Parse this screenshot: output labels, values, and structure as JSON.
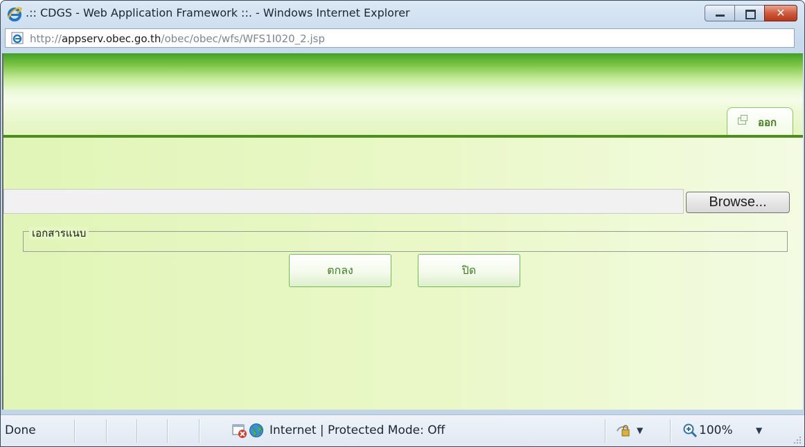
{
  "window": {
    "title": ".:: CDGS - Web Application Framework ::. - Windows Internet Explorer",
    "controls": {
      "minimize": "minimize",
      "maximize": "maximize",
      "close": "✕"
    }
  },
  "address": {
    "prefix": "http://",
    "host": "appserv.obec.go.th",
    "path": "/obec/obec/wfs/WFS1I020_2.jsp"
  },
  "page": {
    "logout_label": "ออก",
    "file_input_value": "",
    "browse_label": "Browse...",
    "attachment_legend": "เอกสารแนบ",
    "ok_label": "ตกลง",
    "close_label": "ปิด"
  },
  "status": {
    "text": "Done",
    "zone": "Internet | Protected Mode: Off",
    "zoom": "100%"
  },
  "icons": {
    "app": "internet-explorer-icon",
    "page": "internet-explorer-page-icon",
    "logout": "window-icon",
    "blocker": "popup-blocked-icon",
    "zone": "globe-icon",
    "protected": "protected-mode-icon",
    "zoom": "magnifier-icon"
  },
  "colors": {
    "header_green": "#41a126",
    "header_line": "#4d8d1f",
    "button_text": "#3d7f1e",
    "logout_text": "#3f7f15",
    "close_button": "#cf5a3c"
  }
}
